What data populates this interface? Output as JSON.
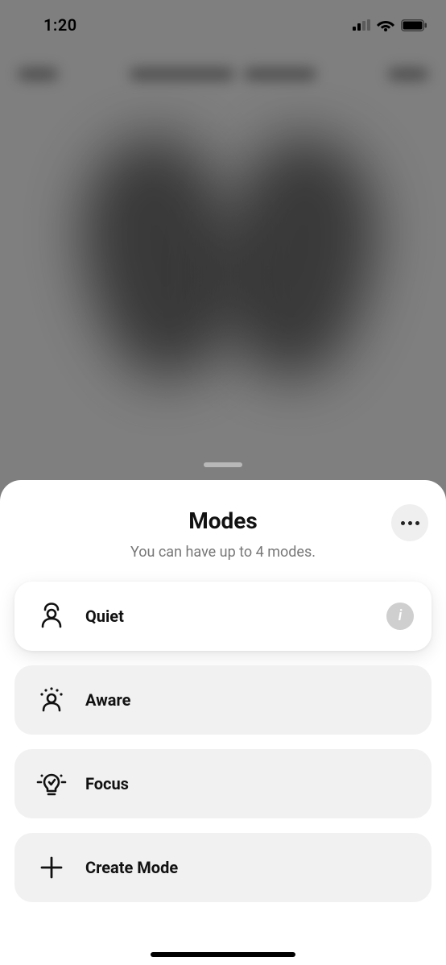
{
  "status": {
    "time": "1:20"
  },
  "sheet": {
    "title": "Modes",
    "subtitle": "You can have up to 4 modes."
  },
  "modes": [
    {
      "label": "Quiet",
      "icon": "quiet-icon",
      "selected": true
    },
    {
      "label": "Aware",
      "icon": "aware-icon",
      "selected": false
    },
    {
      "label": "Focus",
      "icon": "focus-icon",
      "selected": false
    }
  ],
  "create": {
    "label": "Create Mode"
  },
  "info_glyph": "i"
}
